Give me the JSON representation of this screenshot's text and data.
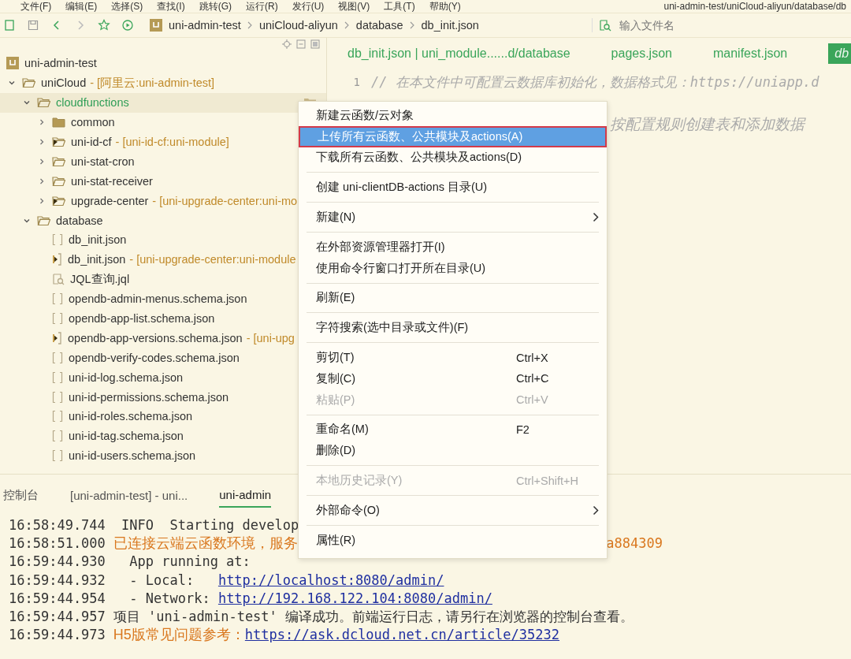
{
  "menu_bar": {
    "items": [
      "文件(F)",
      "编辑(E)",
      "选择(S)",
      "查找(I)",
      "跳转(G)",
      "运行(R)",
      "发行(U)",
      "视图(V)",
      "工具(T)",
      "帮助(Y)"
    ],
    "title": "uni-admin-test/uniCloud-aliyun/database/db"
  },
  "toolbar": {
    "breadcrumb": [
      "uni-admin-test",
      "uniCloud-aliyun",
      "database",
      "db_init.json"
    ],
    "search": {
      "placeholder": "输入文件名"
    }
  },
  "tree": [
    {
      "kind": "project",
      "label": "uni-admin-test",
      "selected": false,
      "children": [
        {
          "kind": "folder",
          "label": "uniCloud",
          "suffix": "- [阿里云:uni-admin-test]",
          "expanded": true,
          "selected": false,
          "children": [
            {
              "kind": "folder",
              "label": "cloudfunctions",
              "expanded": true,
              "selected": true,
              "children": [
                {
                  "kind": "folder",
                  "label": "common",
                  "expanded": false,
                  "selected": false
                },
                {
                  "kind": "module",
                  "label": "uni-id-cf",
                  "suffix": "- [uni-id-cf:uni-module]",
                  "expanded": false,
                  "selected": false
                },
                {
                  "kind": "plain",
                  "label": "uni-stat-cron",
                  "expanded": false,
                  "selected": false
                },
                {
                  "kind": "plain",
                  "label": "uni-stat-receiver",
                  "expanded": false,
                  "selected": false
                },
                {
                  "kind": "module",
                  "label": "upgrade-center",
                  "suffix": "- [uni-upgrade-center:uni-mo",
                  "expanded": false,
                  "selected": false
                }
              ]
            },
            {
              "kind": "folder",
              "label": "database",
              "expanded": true,
              "selected": false,
              "children": [
                {
                  "kind": "file",
                  "label": "db_init.json",
                  "selected": false
                },
                {
                  "kind": "module-file",
                  "label": "db_init.json",
                  "suffix": "- [uni-upgrade-center:uni-module",
                  "selected": false
                },
                {
                  "kind": "query",
                  "label": "JQL查询.jql",
                  "selected": false
                },
                {
                  "kind": "file",
                  "label": "opendb-admin-menus.schema.json",
                  "selected": false
                },
                {
                  "kind": "file",
                  "label": "opendb-app-list.schema.json",
                  "selected": false
                },
                {
                  "kind": "module-file",
                  "label": "opendb-app-versions.schema.json",
                  "suffix": "- [uni-upg",
                  "selected": false
                },
                {
                  "kind": "file",
                  "label": "opendb-verify-codes.schema.json",
                  "selected": false
                },
                {
                  "kind": "file",
                  "label": "uni-id-log.schema.json",
                  "selected": false
                },
                {
                  "kind": "file",
                  "label": "uni-id-permissions.schema.json",
                  "selected": false
                },
                {
                  "kind": "file",
                  "label": "uni-id-roles.schema.json",
                  "selected": false
                },
                {
                  "kind": "file",
                  "label": "uni-id-tag.schema.json",
                  "selected": false
                },
                {
                  "kind": "file",
                  "label": "uni-id-users.schema.json",
                  "selected": false
                }
              ]
            }
          ]
        }
      ]
    }
  ],
  "editor": {
    "tabs": [
      {
        "label": "db_init.json | uni_module......d/database",
        "selected": false
      },
      {
        "label": "pages.json",
        "selected": false
      },
      {
        "label": "manifest.json",
        "selected": false
      },
      {
        "label": "db",
        "selected": true
      }
    ],
    "lines": [
      {
        "kind": "full",
        "number": "1",
        "text": "// 在本文件中可配置云数据库初始化，数据格式见：https://uniapp.d"
      },
      {
        "kind": "partial",
        "text": "按配置规则创建表和添加数据"
      }
    ]
  },
  "console": {
    "tabs": [
      {
        "label": "控制台",
        "selected": false
      },
      {
        "label": "[uni-admin-test] - uni...",
        "selected": false
      },
      {
        "label": "uni-admin",
        "selected": true
      }
    ],
    "lines": [
      {
        "time": "16:58:49.744",
        "parts": [
          {
            "kind": "text",
            "text": " INFO  Starting develop"
          }
        ]
      },
      {
        "time": "16:58:51.000",
        "parts": [
          {
            "kind": "warn",
            "text": "已连接云端云函数环境，服务"
          },
          {
            "kind": "warn-tail",
            "text": "a884309"
          }
        ]
      },
      {
        "time": "16:59:44.930",
        "parts": [
          {
            "kind": "text",
            "text": "  App running at:"
          }
        ]
      },
      {
        "time": "16:59:44.932",
        "parts": [
          {
            "kind": "text",
            "text": "  - Local:   "
          },
          {
            "kind": "link",
            "text": "http://localhost:8080/admin/"
          }
        ]
      },
      {
        "time": "16:59:44.954",
        "parts": [
          {
            "kind": "text",
            "text": "  - Network: "
          },
          {
            "kind": "link",
            "text": "http://192.168.122.104:8080/admin/"
          }
        ]
      },
      {
        "time": "16:59:44.957",
        "parts": [
          {
            "kind": "text",
            "text": "项目 'uni-admin-test' 编译成功。前端运行日志，请另行在浏览器的控制台查看。"
          }
        ]
      },
      {
        "time": "16:59:44.973",
        "parts": [
          {
            "kind": "warn",
            "text": "H5版常见问题参考："
          },
          {
            "kind": "link",
            "text": "https://ask.dcloud.net.cn/article/35232"
          }
        ]
      }
    ]
  },
  "context_menu": {
    "groups": [
      [
        {
          "label": "新建云函数/云对象",
          "selected": false,
          "disabled": false
        },
        {
          "label": "上传所有云函数、公共模块及actions(A)",
          "selected": true,
          "disabled": false
        },
        {
          "label": "下载所有云函数、公共模块及actions(D)",
          "selected": false,
          "disabled": false
        }
      ],
      [
        {
          "label": "创建 uni-clientDB-actions 目录(U)",
          "selected": false,
          "disabled": false
        }
      ],
      [
        {
          "label": "新建(N)",
          "selected": false,
          "disabled": false,
          "submenu": true
        }
      ],
      [
        {
          "label": "在外部资源管理器打开(I)",
          "selected": false,
          "disabled": false
        },
        {
          "label": "使用命令行窗口打开所在目录(U)",
          "selected": false,
          "disabled": false
        }
      ],
      [
        {
          "label": "刷新(E)",
          "selected": false,
          "disabled": false
        }
      ],
      [
        {
          "label": "字符搜索(选中目录或文件)(F)",
          "selected": false,
          "disabled": false
        }
      ],
      [
        {
          "label": "剪切(T)",
          "shortcut": "Ctrl+X",
          "selected": false,
          "disabled": false
        },
        {
          "label": "复制(C)",
          "shortcut": "Ctrl+C",
          "selected": false,
          "disabled": false
        },
        {
          "label": "粘贴(P)",
          "shortcut": "Ctrl+V",
          "selected": false,
          "disabled": true
        }
      ],
      [
        {
          "label": "重命名(M)",
          "shortcut": "F2",
          "selected": false,
          "disabled": false
        },
        {
          "label": "删除(D)",
          "selected": false,
          "disabled": false
        }
      ],
      [
        {
          "label": "本地历史记录(Y)",
          "shortcut": "Ctrl+Shift+H",
          "selected": false,
          "disabled": true
        }
      ],
      [
        {
          "label": "外部命令(O)",
          "selected": false,
          "disabled": false,
          "submenu": true
        }
      ],
      [
        {
          "label": "属性(R)",
          "selected": false,
          "disabled": false
        }
      ]
    ]
  }
}
